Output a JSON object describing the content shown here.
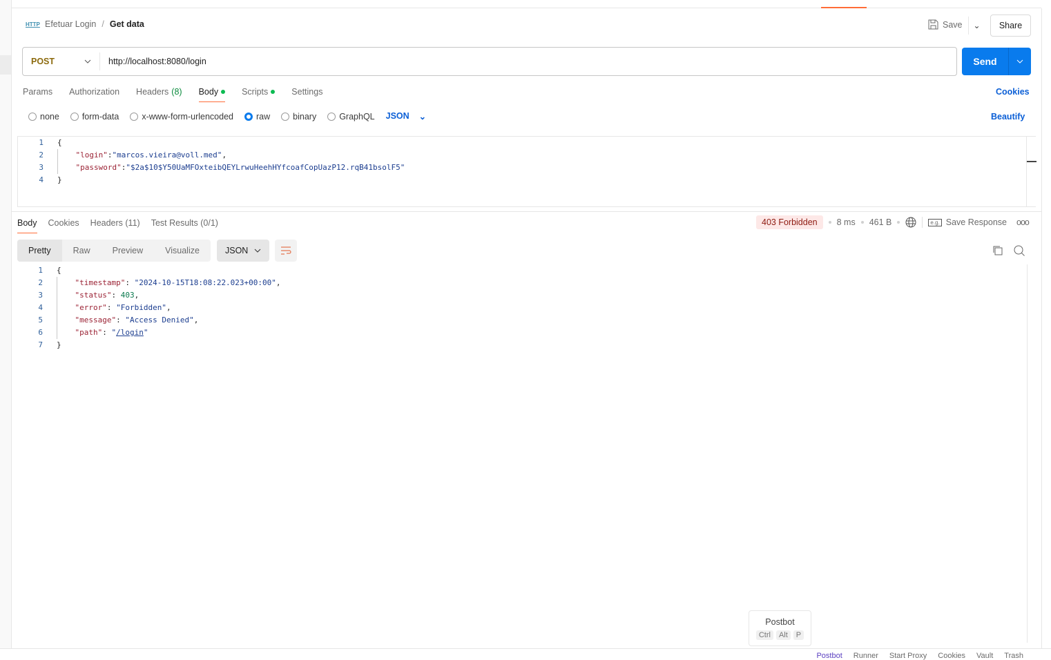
{
  "breadcrumb": {
    "icon": "HTTP",
    "parent": "Efetuar Login",
    "separator": "/",
    "current": "Get data"
  },
  "header": {
    "save_label": "Save",
    "share_label": "Share"
  },
  "request": {
    "method": "POST",
    "url": "http://localhost:8080/login",
    "send_label": "Send"
  },
  "request_tabs": [
    {
      "label": "Params"
    },
    {
      "label": "Authorization"
    },
    {
      "label": "Headers",
      "count": "(8)"
    },
    {
      "label": "Body",
      "active": true,
      "dot": true
    },
    {
      "label": "Scripts",
      "dot": true
    },
    {
      "label": "Settings"
    }
  ],
  "cookies_link": "Cookies",
  "body_types": [
    "none",
    "form-data",
    "x-www-form-urlencoded",
    "raw",
    "binary",
    "GraphQL"
  ],
  "body_type_selected": "raw",
  "body_format": "JSON",
  "beautify_label": "Beautify",
  "request_body": {
    "line_numbers": [
      "1",
      "2",
      "3",
      "4"
    ],
    "open": "{",
    "close": "}",
    "login_key": "\"login\"",
    "login_val": "\"marcos.vieira@voll.med\"",
    "password_key": "\"password\"",
    "password_val": "\"$2a$10$Y50UaMFOxteibQEYLrwuHeehHYfcoafCopUazP12.rqB41bsolF5\""
  },
  "response_tabs": [
    {
      "label": "Body",
      "active": true
    },
    {
      "label": "Cookies"
    },
    {
      "label": "Headers (11)"
    },
    {
      "label": "Test Results (0/1)"
    }
  ],
  "response_meta": {
    "status": "403 Forbidden",
    "time": "8 ms",
    "size": "461 B",
    "save_response": "Save Response"
  },
  "view_modes": [
    "Pretty",
    "Raw",
    "Preview",
    "Visualize"
  ],
  "response_format": "JSON",
  "response_body": {
    "line_numbers": [
      "1",
      "2",
      "3",
      "4",
      "5",
      "6",
      "7"
    ],
    "open": "{",
    "close": "}",
    "timestamp_key": "\"timestamp\"",
    "timestamp_val": "\"2024-10-15T18:08:22.023+00:00\"",
    "status_key": "\"status\"",
    "status_val": "403",
    "error_key": "\"error\"",
    "error_val": "\"Forbidden\"",
    "message_key": "\"message\"",
    "message_val": "\"Access Denied\"",
    "path_key": "\"path\"",
    "path_val": "/login"
  },
  "postbot_popup": {
    "title": "Postbot",
    "keys": [
      "Ctrl",
      "Alt",
      "P"
    ]
  },
  "statusbar": [
    "Postbot",
    "Runner",
    "Start Proxy",
    "Cookies",
    "Vault",
    "Trash"
  ],
  "colors": {
    "accent": "#097bed",
    "tab_underline": "#ff6c37",
    "error_badge_bg": "#fde8e7",
    "method": "#8c6a0d"
  }
}
